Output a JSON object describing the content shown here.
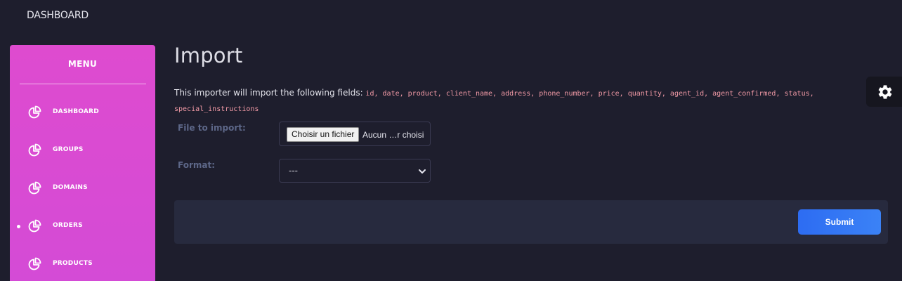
{
  "topbar": {
    "title": "DASHBOARD"
  },
  "sidebar": {
    "menu_title": "MENU",
    "items": [
      {
        "label": "DASHBOARD",
        "icon": "pie-chart-icon",
        "active": false
      },
      {
        "label": "GROUPS",
        "icon": "pie-chart-icon",
        "active": false
      },
      {
        "label": "DOMAINS",
        "icon": "pie-chart-icon",
        "active": false
      },
      {
        "label": "ORDERS",
        "icon": "pie-chart-icon",
        "active": true
      },
      {
        "label": "PRODUCTS",
        "icon": "pie-chart-icon",
        "active": false
      }
    ]
  },
  "main": {
    "title": "Import",
    "intro_text": "This importer will import the following fields:",
    "fields_list": "id, date, product, client_name, address, phone_number, price, quantity, agent_id, agent_confirmed, status, special_instructions",
    "file_label": "File to import:",
    "file_button": "Choisir un fichier",
    "file_status": "Aucun …r choisi",
    "format_label": "Format:",
    "format_selected": "---",
    "submit_label": "Submit"
  },
  "colors": {
    "background": "#1e1e2d",
    "sidebar": "#dc4bd0",
    "accent": "#2d6cf2",
    "field_highlight": "#f29aa6",
    "panel": "#272a3e"
  },
  "icons": {
    "settings": "gear-icon",
    "select": "chevron-down-icon"
  }
}
